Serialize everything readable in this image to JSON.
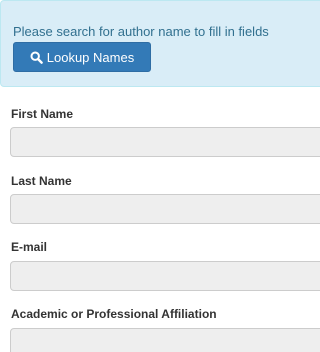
{
  "info": {
    "message": "Please search for author name to fill in fields",
    "lookup_button_label": "Lookup Names",
    "lookup_icon": "search-icon"
  },
  "fields": {
    "first_name": {
      "label": "First Name",
      "value": ""
    },
    "last_name": {
      "label": "Last Name",
      "value": ""
    },
    "email": {
      "label": "E-mail",
      "value": ""
    },
    "affiliation": {
      "label": "Academic or Professional Affiliation",
      "value": ""
    }
  },
  "colors": {
    "info_background": "#d9edf7",
    "info_text": "#31708f",
    "button_primary": "#337ab7",
    "input_background": "#eeeeee"
  }
}
